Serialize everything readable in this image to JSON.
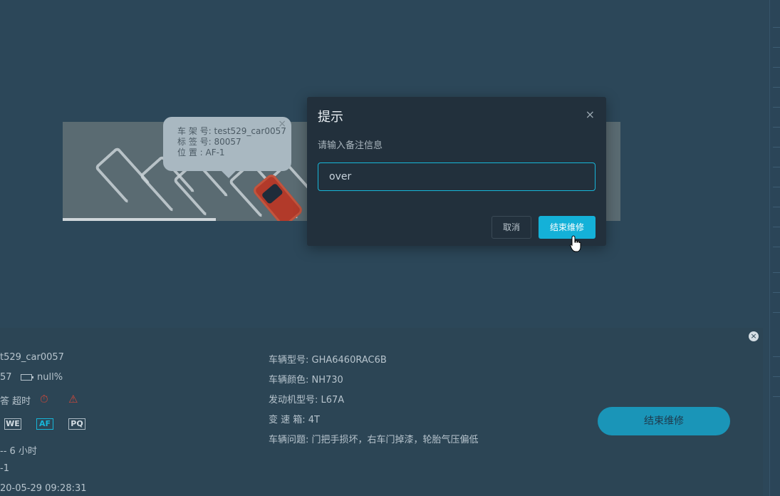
{
  "tooltip": {
    "frame_no": "车 架 号: test529_car0057",
    "tag_no": "标 签 号: 80057",
    "position": "位 置 : AF-1",
    "close": "×"
  },
  "modal": {
    "title": "提示",
    "close": "×",
    "message": "请输入备注信息",
    "input_value": "over",
    "cancel_label": "取消",
    "confirm_label": "结束维修"
  },
  "panel": {
    "close": "×",
    "left": {
      "frame_partial": "t529_car0057",
      "tag_partial": "57",
      "battery": "null%",
      "status": "答 超时",
      "badges": [
        "WE",
        "AF",
        "PQ"
      ],
      "active_badge": "AF",
      "duration": "-- 6 小时",
      "position_partial": "-1",
      "datetime_partial": "20-05-29 09:28:31"
    },
    "right": {
      "model": "车辆型号: GHA6460RAC6B",
      "color": "车辆颜色: NH730",
      "engine": "发动机型号: L67A",
      "gearbox": "变 速 箱: 4T",
      "problem": "车辆问题: 门把手损坏，右车门掉漆，轮胎气压偏低"
    },
    "action_label": "结束维修"
  },
  "colors": {
    "accent": "#14b1d8",
    "alarm": "#d0483a",
    "panel_bg": "#2c4555",
    "modal_bg": "#22303c"
  }
}
